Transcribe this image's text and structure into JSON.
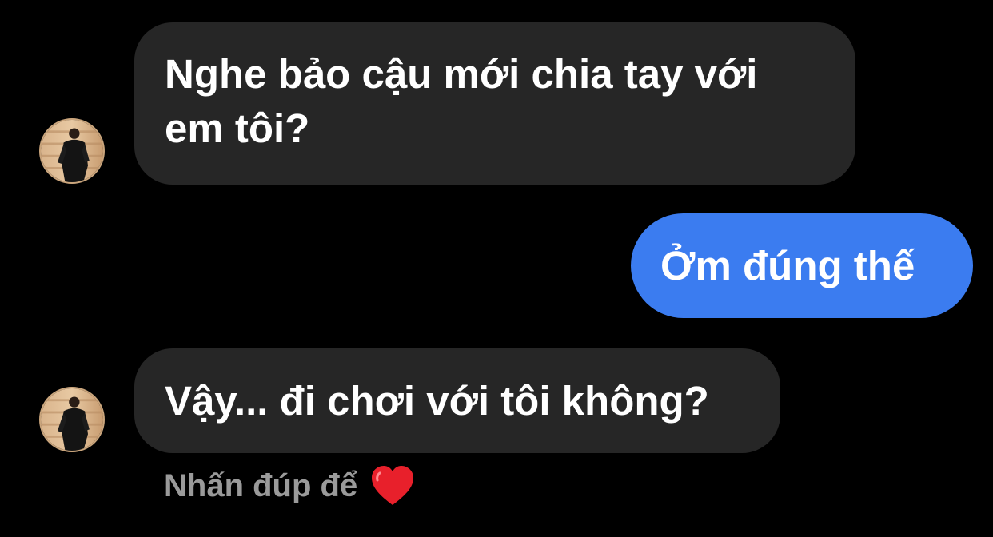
{
  "conversation": {
    "messages": [
      {
        "direction": "incoming",
        "text_lines": [
          "Nghe bảo cậu mới chia tay với",
          "em tôi?"
        ]
      },
      {
        "direction": "outgoing",
        "text": "Ởm đúng thế"
      },
      {
        "direction": "incoming",
        "text": "Vậy... đi chơi với tôi không?"
      }
    ],
    "hint": {
      "text": "Nhấn đúp để",
      "icon": "heart-icon"
    }
  },
  "colors": {
    "background": "#000000",
    "incoming_bubble": "#262626",
    "outgoing_bubble": "#3b7cf0",
    "hint_text": "#9a9a9a",
    "heart": "#e8202b"
  }
}
